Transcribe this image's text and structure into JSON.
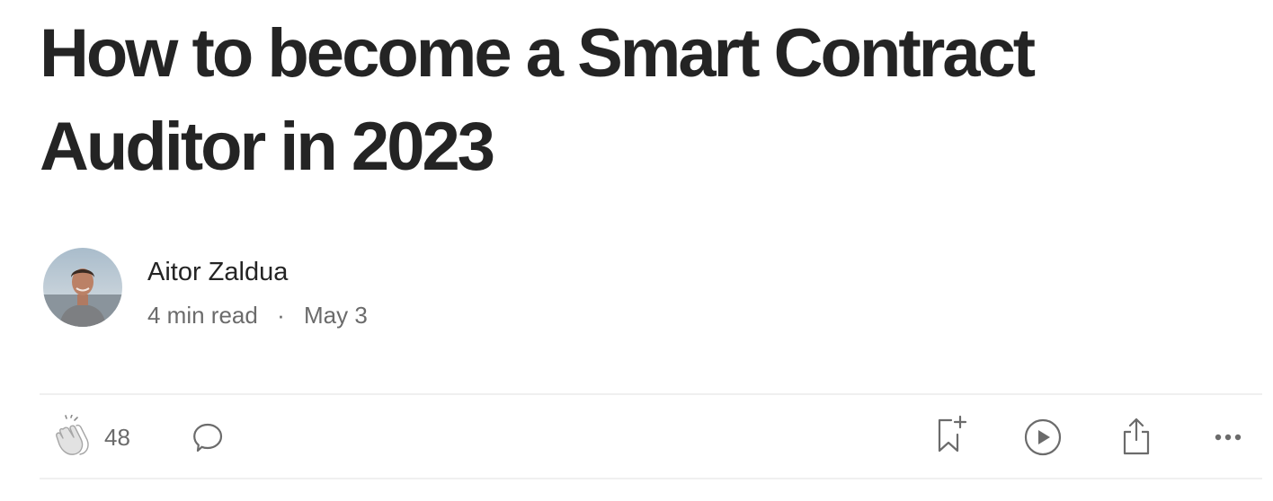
{
  "article": {
    "title": "How to become a Smart Contract Auditor in 2023"
  },
  "author": {
    "name": "Aitor Zaldua",
    "read_time": "4 min read",
    "separator": "·",
    "date": "May 3"
  },
  "actions": {
    "clap_count": "48",
    "icons": [
      "clap-icon",
      "comment-icon",
      "bookmark-add-icon",
      "play-icon",
      "share-icon",
      "more-icon"
    ]
  },
  "colors": {
    "text_primary": "#242424",
    "text_secondary": "#6b6b6b",
    "icon": "#6b6b6b",
    "divider": "#f0f0f0"
  }
}
